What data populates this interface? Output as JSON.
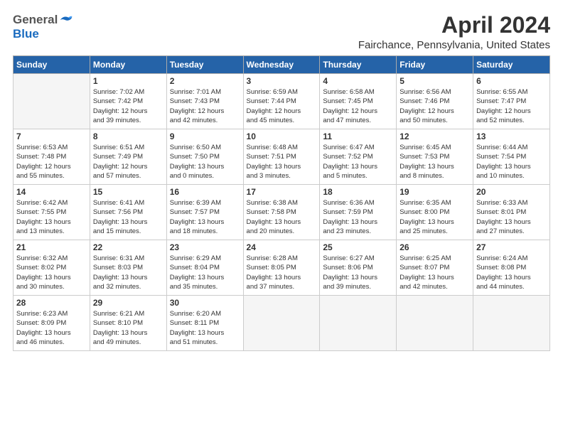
{
  "header": {
    "logo_general": "General",
    "logo_blue": "Blue",
    "title": "April 2024",
    "subtitle": "Fairchance, Pennsylvania, United States"
  },
  "weekdays": [
    "Sunday",
    "Monday",
    "Tuesday",
    "Wednesday",
    "Thursday",
    "Friday",
    "Saturday"
  ],
  "weeks": [
    [
      {
        "day": "",
        "info": ""
      },
      {
        "day": "1",
        "info": "Sunrise: 7:02 AM\nSunset: 7:42 PM\nDaylight: 12 hours\nand 39 minutes."
      },
      {
        "day": "2",
        "info": "Sunrise: 7:01 AM\nSunset: 7:43 PM\nDaylight: 12 hours\nand 42 minutes."
      },
      {
        "day": "3",
        "info": "Sunrise: 6:59 AM\nSunset: 7:44 PM\nDaylight: 12 hours\nand 45 minutes."
      },
      {
        "day": "4",
        "info": "Sunrise: 6:58 AM\nSunset: 7:45 PM\nDaylight: 12 hours\nand 47 minutes."
      },
      {
        "day": "5",
        "info": "Sunrise: 6:56 AM\nSunset: 7:46 PM\nDaylight: 12 hours\nand 50 minutes."
      },
      {
        "day": "6",
        "info": "Sunrise: 6:55 AM\nSunset: 7:47 PM\nDaylight: 12 hours\nand 52 minutes."
      }
    ],
    [
      {
        "day": "7",
        "info": "Sunrise: 6:53 AM\nSunset: 7:48 PM\nDaylight: 12 hours\nand 55 minutes."
      },
      {
        "day": "8",
        "info": "Sunrise: 6:51 AM\nSunset: 7:49 PM\nDaylight: 12 hours\nand 57 minutes."
      },
      {
        "day": "9",
        "info": "Sunrise: 6:50 AM\nSunset: 7:50 PM\nDaylight: 13 hours\nand 0 minutes."
      },
      {
        "day": "10",
        "info": "Sunrise: 6:48 AM\nSunset: 7:51 PM\nDaylight: 13 hours\nand 3 minutes."
      },
      {
        "day": "11",
        "info": "Sunrise: 6:47 AM\nSunset: 7:52 PM\nDaylight: 13 hours\nand 5 minutes."
      },
      {
        "day": "12",
        "info": "Sunrise: 6:45 AM\nSunset: 7:53 PM\nDaylight: 13 hours\nand 8 minutes."
      },
      {
        "day": "13",
        "info": "Sunrise: 6:44 AM\nSunset: 7:54 PM\nDaylight: 13 hours\nand 10 minutes."
      }
    ],
    [
      {
        "day": "14",
        "info": "Sunrise: 6:42 AM\nSunset: 7:55 PM\nDaylight: 13 hours\nand 13 minutes."
      },
      {
        "day": "15",
        "info": "Sunrise: 6:41 AM\nSunset: 7:56 PM\nDaylight: 13 hours\nand 15 minutes."
      },
      {
        "day": "16",
        "info": "Sunrise: 6:39 AM\nSunset: 7:57 PM\nDaylight: 13 hours\nand 18 minutes."
      },
      {
        "day": "17",
        "info": "Sunrise: 6:38 AM\nSunset: 7:58 PM\nDaylight: 13 hours\nand 20 minutes."
      },
      {
        "day": "18",
        "info": "Sunrise: 6:36 AM\nSunset: 7:59 PM\nDaylight: 13 hours\nand 23 minutes."
      },
      {
        "day": "19",
        "info": "Sunrise: 6:35 AM\nSunset: 8:00 PM\nDaylight: 13 hours\nand 25 minutes."
      },
      {
        "day": "20",
        "info": "Sunrise: 6:33 AM\nSunset: 8:01 PM\nDaylight: 13 hours\nand 27 minutes."
      }
    ],
    [
      {
        "day": "21",
        "info": "Sunrise: 6:32 AM\nSunset: 8:02 PM\nDaylight: 13 hours\nand 30 minutes."
      },
      {
        "day": "22",
        "info": "Sunrise: 6:31 AM\nSunset: 8:03 PM\nDaylight: 13 hours\nand 32 minutes."
      },
      {
        "day": "23",
        "info": "Sunrise: 6:29 AM\nSunset: 8:04 PM\nDaylight: 13 hours\nand 35 minutes."
      },
      {
        "day": "24",
        "info": "Sunrise: 6:28 AM\nSunset: 8:05 PM\nDaylight: 13 hours\nand 37 minutes."
      },
      {
        "day": "25",
        "info": "Sunrise: 6:27 AM\nSunset: 8:06 PM\nDaylight: 13 hours\nand 39 minutes."
      },
      {
        "day": "26",
        "info": "Sunrise: 6:25 AM\nSunset: 8:07 PM\nDaylight: 13 hours\nand 42 minutes."
      },
      {
        "day": "27",
        "info": "Sunrise: 6:24 AM\nSunset: 8:08 PM\nDaylight: 13 hours\nand 44 minutes."
      }
    ],
    [
      {
        "day": "28",
        "info": "Sunrise: 6:23 AM\nSunset: 8:09 PM\nDaylight: 13 hours\nand 46 minutes."
      },
      {
        "day": "29",
        "info": "Sunrise: 6:21 AM\nSunset: 8:10 PM\nDaylight: 13 hours\nand 49 minutes."
      },
      {
        "day": "30",
        "info": "Sunrise: 6:20 AM\nSunset: 8:11 PM\nDaylight: 13 hours\nand 51 minutes."
      },
      {
        "day": "",
        "info": ""
      },
      {
        "day": "",
        "info": ""
      },
      {
        "day": "",
        "info": ""
      },
      {
        "day": "",
        "info": ""
      }
    ]
  ]
}
